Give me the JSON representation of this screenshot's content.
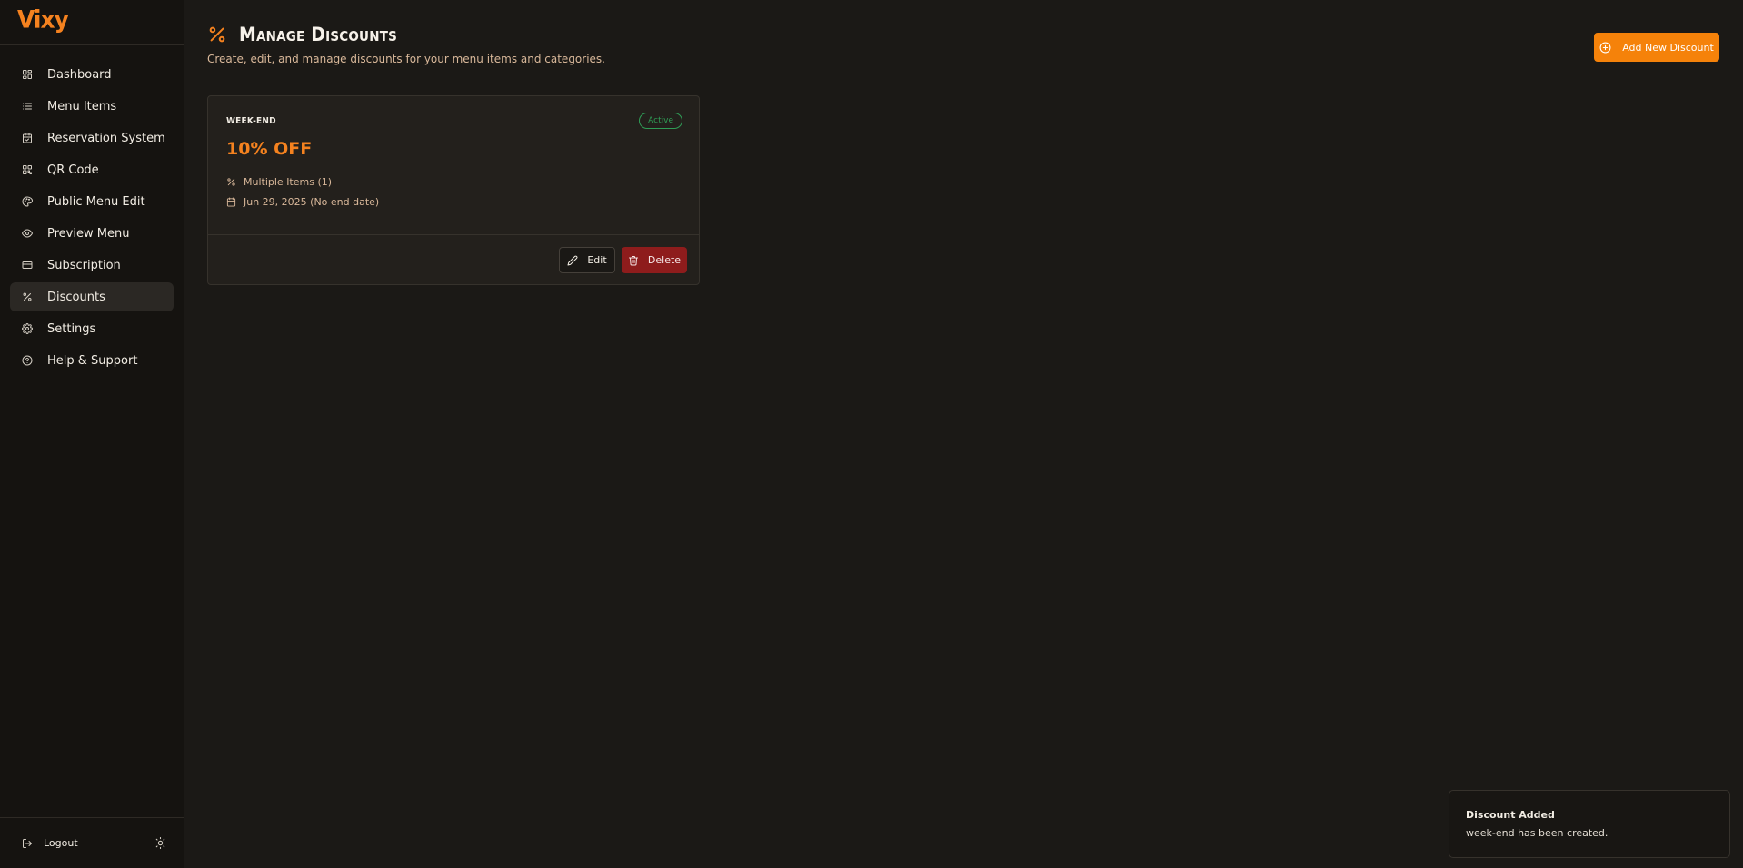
{
  "app": {
    "logo_text": "Vixy"
  },
  "sidebar": {
    "items": [
      {
        "label": "Dashboard",
        "icon": "grid-icon"
      },
      {
        "label": "Menu Items",
        "icon": "list-icon"
      },
      {
        "label": "Reservation System",
        "icon": "calendar-check-icon"
      },
      {
        "label": "QR Code",
        "icon": "qr-code-icon"
      },
      {
        "label": "Public Menu Edit",
        "icon": "palette-icon"
      },
      {
        "label": "Preview Menu",
        "icon": "eye-icon"
      },
      {
        "label": "Subscription",
        "icon": "credit-card-icon"
      },
      {
        "label": "Discounts",
        "icon": "percent-icon",
        "active": true
      },
      {
        "label": "Settings",
        "icon": "gear-icon"
      },
      {
        "label": "Help & Support",
        "icon": "help-circle-icon"
      }
    ],
    "footer": {
      "logout_label": "Logout",
      "theme_icon": "sun-icon"
    }
  },
  "header": {
    "title": "Manage Discounts",
    "subtitle": "Create, edit, and manage discounts for your menu items and categories.",
    "add_button_label": "Add New Discount"
  },
  "discounts": [
    {
      "name": "WEEK-END",
      "status": "Active",
      "value": "10% OFF",
      "scope": "Multiple Items (1)",
      "dates": "Jun 29, 2025 (No end date)",
      "edit_label": "Edit",
      "delete_label": "Delete"
    }
  ],
  "toast": {
    "title": "Discount Added",
    "description": "week-end has been created."
  },
  "colors": {
    "accent": "#f5821f",
    "background": "#1b1916",
    "sidebar_bg": "#151310",
    "active_badge": "#2f9c55",
    "danger": "#8e1c1c"
  }
}
